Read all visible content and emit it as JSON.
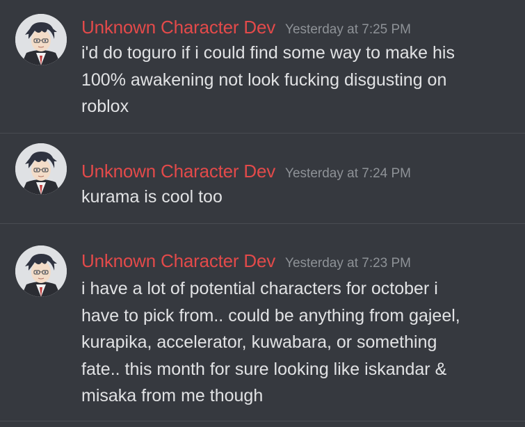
{
  "messages": [
    {
      "author": "Unknown Character Dev",
      "timestamp": "Yesterday at 7:25 PM",
      "text": "i'd do toguro if i could find some way to make his\n100% awakening not look fucking disgusting on\nroblox"
    },
    {
      "author": "Unknown Character Dev",
      "timestamp": "Yesterday at 7:24 PM",
      "text": "kurama is cool too"
    },
    {
      "author": "Unknown Character Dev",
      "timestamp": "Yesterday at 7:23 PM",
      "text": "i have a lot of potential characters for october i\nhave to pick from.. could be anything from gajeel,\nkurapika, accelerator, kuwabara, or something\nfate.. this month for sure looking like iskandar &\nmisaka from me though"
    }
  ],
  "colors": {
    "background": "#36393f",
    "username": "#e34a4a",
    "timestamp": "#8e9297",
    "message_text": "#e1e2e4",
    "divider": "#494c52"
  },
  "icons": {
    "avatar": "anime-character-avatar"
  }
}
